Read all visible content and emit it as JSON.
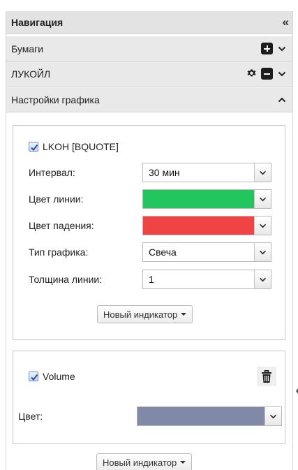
{
  "nav": {
    "title": "Навигация",
    "collapse_icon": "double-chevron-left-icon"
  },
  "papers": {
    "title": "Бумаги"
  },
  "instrument": {
    "title": "ЛУКОЙЛ"
  },
  "settings": {
    "title": "Настройки графика"
  },
  "main_series": {
    "checkbox_label": "LKOH [BQUOTE]",
    "checked": true,
    "fields": [
      {
        "label": "Интервал:",
        "value": "30 мин"
      },
      {
        "label": "Цвет линии:",
        "color": "#22c55e"
      },
      {
        "label": "Цвет падения:",
        "color": "#f04444"
      },
      {
        "label": "Тип графика:",
        "value": "Свеча"
      },
      {
        "label": "Толщина линии:",
        "value": "1"
      }
    ],
    "new_indicator_label": "Новый индикатор"
  },
  "volume": {
    "checkbox_label": "Volume",
    "checked": true,
    "color_label": "Цвет:",
    "color": "#8089a8"
  },
  "footer": {
    "new_indicator_label": "Новый индикатор"
  }
}
